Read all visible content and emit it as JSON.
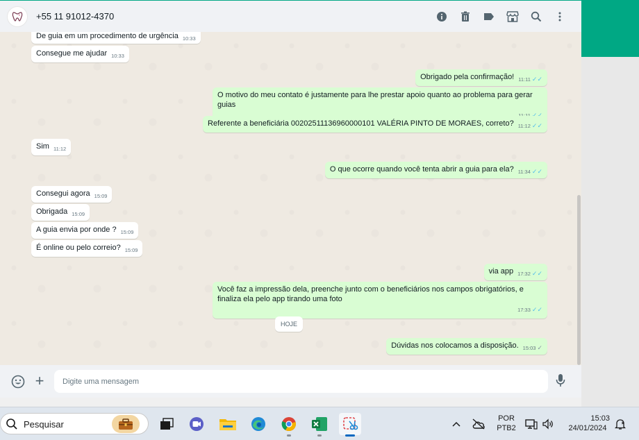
{
  "header": {
    "contact_name": "+55 11 91012-4370",
    "icons": [
      "info-icon",
      "trash-icon",
      "label-icon",
      "store-icon",
      "search-icon",
      "menu-icon"
    ]
  },
  "messages": [
    {
      "dir": "in",
      "text": "De guia em um procedimento de urgência",
      "time": "10:33"
    },
    {
      "dir": "in",
      "text": "Consegue me ajudar",
      "time": "10:33"
    },
    {
      "dir": "out",
      "text": "Obrigado pela confirmação!",
      "time": "11:11"
    },
    {
      "dir": "out",
      "text": "O motivo do meu contato é justamente para lhe prestar apoio quanto ao problema para gerar guias",
      "time": "11:11"
    },
    {
      "dir": "out",
      "text": "Referente a beneficiária 00202511136960000101 VALÉRIA PINTO DE MORAES, correto?",
      "time": "11:12"
    },
    {
      "dir": "in",
      "text": "Sim",
      "time": "11:12"
    },
    {
      "dir": "out",
      "text": "O que ocorre quando você tenta abrir a guia para ela?",
      "time": "11:34"
    },
    {
      "dir": "in",
      "text": "Consegui agora",
      "time": "15:09"
    },
    {
      "dir": "in",
      "text": "Obrigada",
      "time": "15:09"
    },
    {
      "dir": "in",
      "text": "A guia envia por onde ?",
      "time": "15:09"
    },
    {
      "dir": "in",
      "text": "É online ou pelo correio?",
      "time": "15:09"
    },
    {
      "dir": "out",
      "text": "via app",
      "time": "17:32"
    },
    {
      "dir": "out",
      "text": "Você faz a impressão dela, preenche junto com o beneficiários nos campos obrigatórios, e finaliza ela pelo app tirando uma foto",
      "time": "17:33"
    },
    {
      "dir": "out",
      "text": "Dúvidas nos colocamos a disposição.",
      "time": "15:03"
    }
  ],
  "date_chip": "HOJE",
  "composer": {
    "placeholder": "Digite uma mensagem"
  },
  "taskbar": {
    "search_label": "Pesquisar",
    "lang_top": "POR",
    "lang_bottom": "PTB2",
    "time": "15:03",
    "date": "24/01/2024"
  },
  "colors": {
    "accent": "#00a884",
    "incoming_bubble": "#ffffff",
    "outgoing_bubble": "#d9fdd3",
    "read_ticks": "#53bdeb"
  }
}
